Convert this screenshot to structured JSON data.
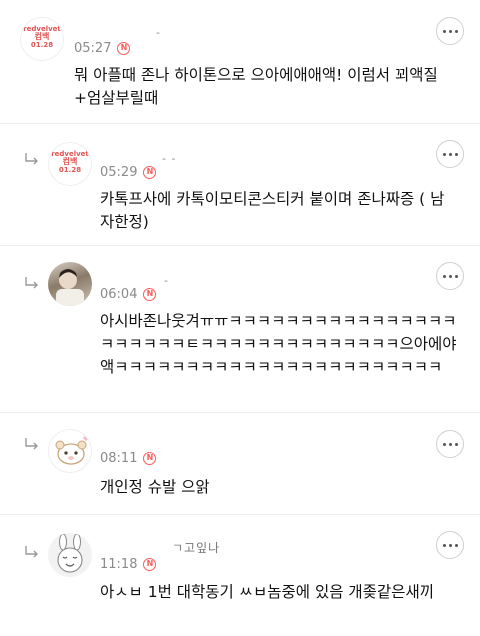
{
  "comments": [
    {
      "nickname": "-",
      "time": "05:27",
      "new_badge": "N",
      "text": "뭐 아플때 존나 하이톤으로 으아에애애액! 이럼서 꾀액질 +엄살부릴때",
      "avatar_lines": [
        "redvelvet",
        "컴백",
        "01.28"
      ]
    },
    {
      "nickname": "-  -",
      "time": "05:29",
      "new_badge": "N",
      "text": "카톡프사에 카톡이모티콘스티커 붙이며 존나짜증 ( 남자한정)",
      "avatar_lines": [
        "redvelvet",
        "컴백",
        "01.28"
      ]
    },
    {
      "nickname": "-",
      "time": "06:04",
      "new_badge": "N",
      "text": "아시바존나웃겨ㅠㅠㅋㅋㅋㅋㅋㅋㅋㅋㅋㅋㅋㅋㅋㅋㅋㅋㅋㅋㅋㅋㅋㅋㅌㅋㅋㅋㅋㅋㅋㅋㅋㅋㅋㅋㅋㅋㅋ으아에야액ㅋㅋㅋㅋㅋㅋㅋㅋㅋㅋㅋㅋㅋㅋㅋㅋㅋㅋㅋㅋㅋㅋㅋ"
    },
    {
      "nickname": "",
      "time": "08:11",
      "new_badge": "N",
      "text": "개인정 슈발 으앍"
    },
    {
      "nickname": "ㄱ고잎나",
      "time": "11:18",
      "new_badge": "N",
      "text": "아ㅅㅂ 1번 대학동기 ㅆㅂ놈중에 있음 개좆같은새끼"
    }
  ],
  "colors": {
    "badge": "#ff5a5a",
    "meta": "#8a8a8a",
    "text": "#111111"
  },
  "icons": {
    "reply": "reply-arrow-icon",
    "more": "more-options-icon",
    "new": "new-badge-icon"
  }
}
